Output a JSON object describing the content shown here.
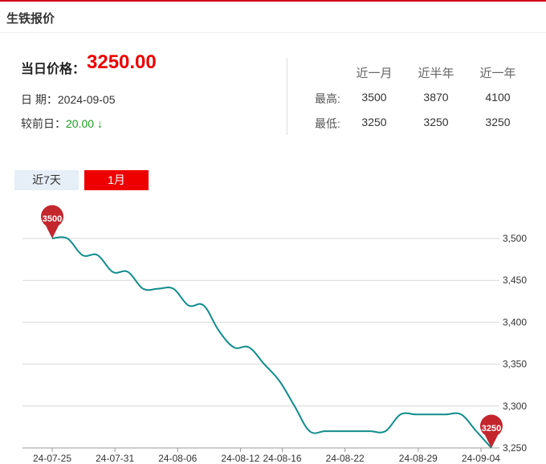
{
  "header": {
    "title": "生铁报价"
  },
  "price": {
    "label": "当日价格：",
    "value": "3250.00",
    "date_label": "日  期：",
    "date": "2024-09-05",
    "change_label": "较前日：",
    "change": "20.00 ↓"
  },
  "stats": {
    "columns": [
      "近一月",
      "近半年",
      "近一年"
    ],
    "rows": [
      {
        "label": "最高:",
        "values": [
          "3500",
          "3870",
          "4100"
        ]
      },
      {
        "label": "最低:",
        "values": [
          "3250",
          "3250",
          "3250"
        ]
      }
    ]
  },
  "tabs": [
    {
      "label": "近7天",
      "active": false
    },
    {
      "label": "1月",
      "active": true
    }
  ],
  "colors": {
    "accent": "#e00000",
    "line": "#118c8c",
    "down": "#1a9d1a",
    "pin": "#c4262e"
  },
  "chart_data": {
    "type": "line",
    "x_ticks": [
      "24-07-25",
      "24-07-31",
      "24-08-06",
      "24-08-12",
      "24-08-16",
      "24-08-22",
      "24-08-29",
      "24-09-04"
    ],
    "y_ticks": [
      "3,250",
      "3,300",
      "3,350",
      "3,400",
      "3,450",
      "3,500"
    ],
    "ylim": [
      3250,
      3500
    ],
    "series": [
      {
        "values": [
          3500,
          3500,
          3480,
          3480,
          3460,
          3460,
          3440,
          3440,
          3440,
          3420,
          3420,
          3390,
          3370,
          3370,
          3350,
          3330,
          3300,
          3270,
          3270,
          3270,
          3270,
          3270,
          3270,
          3290,
          3290,
          3290,
          3290,
          3290,
          3270,
          3250
        ]
      }
    ],
    "markers": [
      {
        "label": "3500",
        "index": 0
      },
      {
        "label": "3250",
        "index": 29
      }
    ],
    "grid": true
  }
}
